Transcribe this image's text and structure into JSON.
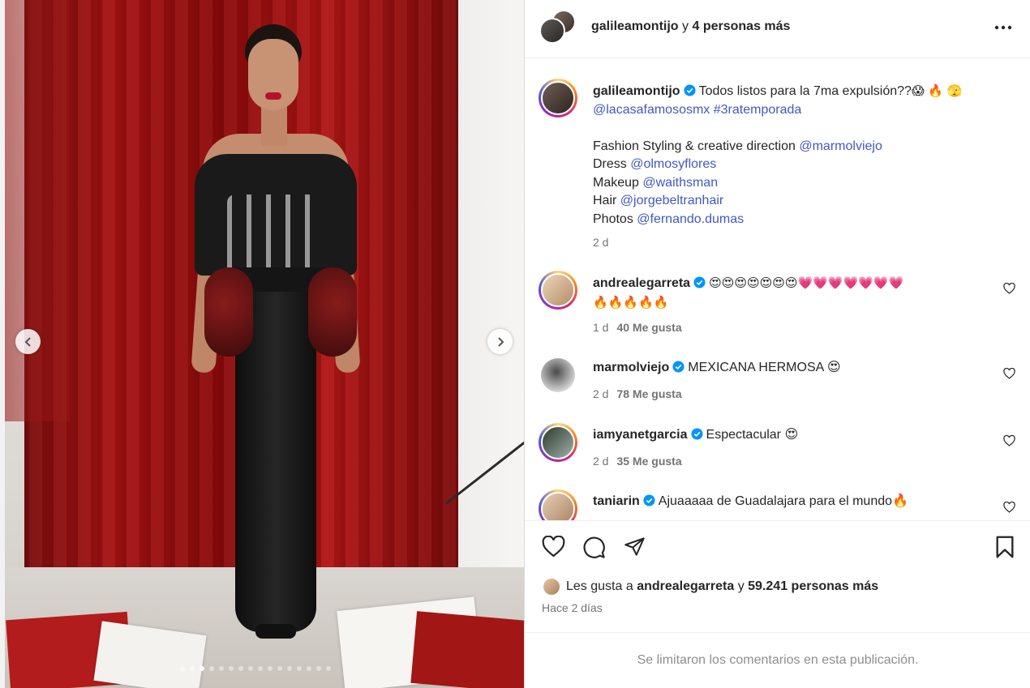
{
  "header": {
    "username": "galileamontijo",
    "joiner": "y",
    "others": "4 personas más"
  },
  "caption": {
    "username": "galileamontijo",
    "text": "Todos listos para la 7ma expulsión??",
    "emojis": "😱 🔥 🫣",
    "mention_show": "@lacasafamososmx",
    "hashtag": "#3ratemporada",
    "credits": [
      {
        "label": "Fashion Styling & creative direction",
        "handle": "@marmolviejo"
      },
      {
        "label": "Dress",
        "handle": "@olmosyflores"
      },
      {
        "label": "Makeup",
        "handle": "@waithsman"
      },
      {
        "label": "Hair",
        "handle": "@jorgebeltranhair"
      },
      {
        "label": "Photos",
        "handle": "@fernando.dumas"
      }
    ],
    "time": "2 d"
  },
  "comments": [
    {
      "username": "andrealegarreta",
      "text": "😍😍😍😍😍😍😍💗💗💗💗💗💗💗",
      "text2": "🔥🔥🔥🔥🔥",
      "time": "1 d",
      "likes": "40 Me gusta"
    },
    {
      "username": "marmolviejo",
      "text": "MEXICANA HERMOSA 😍",
      "time": "2 d",
      "likes": "78 Me gusta"
    },
    {
      "username": "iamyanetgarcia",
      "text": "Espectacular 😍",
      "time": "2 d",
      "likes": "35 Me gusta"
    },
    {
      "username": "taniarin",
      "text": "Ajuaaaaa de Guadalajara para el mundo🔥"
    }
  ],
  "likes": {
    "prefix": "Les gusta a",
    "user": "andrealegarreta",
    "joiner": "y",
    "count": "59.241 personas más"
  },
  "posted": "Hace 2 días",
  "limited_notice": "Se limitaron los comentarios en esta publicación.",
  "carousel": {
    "total": 16,
    "active_index": 2
  },
  "icons": [
    "chevron-left-icon",
    "chevron-right-icon",
    "more-icon",
    "verified-icon",
    "heart-icon",
    "comment-icon",
    "share-icon",
    "bookmark-icon"
  ],
  "colors": {
    "link": "#4158c4",
    "verified": "#0095f6",
    "muted": "#737373"
  }
}
